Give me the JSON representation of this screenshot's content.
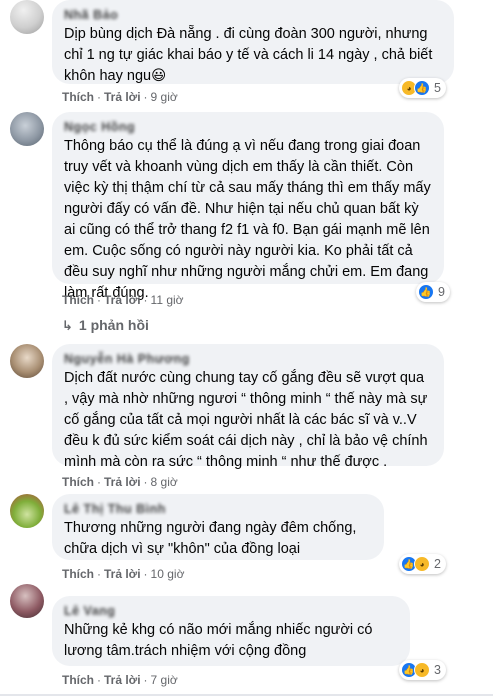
{
  "comments": [
    {
      "author": "Nhã Bảo",
      "text": "Dịp bùng dịch Đà nẵng . đi cùng đoàn 300 người, nhưng chỉ 1 ng tự giác khai báo y tế và cách li 14 ngày , chả biết khôn hay ngu😃",
      "like": "Thích",
      "reply": "Trả lời",
      "time": "9 giờ",
      "reaction_icons": [
        "sad-icon",
        "like-icon"
      ],
      "reaction_count": "5"
    },
    {
      "author": "Ngọc Hồng",
      "text": "Thông báo cụ thể là đúng ạ vì nếu đang trong giai đoan truy vết và khoanh vùng dịch em thấy là cần thiết. Còn việc kỳ thị thậm chí từ cả sau mấy tháng thì em thấy mấy người đấy có vấn đề. Như hiện tại nếu chủ quan bất kỳ ai cũng có thể trở thang f2 f1 và f0. Bạn gái mạnh mẽ lên em. Cuộc sống có người này người kia. Ko phải tất cả đều suy nghĩ như những người mắng chửi em. Em đang làm rất đúng.",
      "like": "Thích",
      "reply": "Trả lời",
      "time": "11 giờ",
      "reaction_icons": [
        "like-icon"
      ],
      "reaction_count": "9",
      "replies_label": "1 phản hồi"
    },
    {
      "author": "Nguyễn Hà Phương",
      "text": "Dịch đất nước cùng chung tay cố gắng đều sẽ vượt qua , vậy mà nhờ những ngươi “ thông minh “ thế này mà sự cố gắng của tất cả mọi người nhất là các bác sĩ và v..V đều k đủ sức kiểm soát cái dịch này , chỉ là bảo vệ chính mình mà còn ra sức “ thông minh “ như thế được .",
      "like": "Thích",
      "reply": "Trả lời",
      "time": "8 giờ"
    },
    {
      "author": "Lê Thị Thu Bình",
      "text": "Thương những người đang ngày đêm chống, chữa dịch vì sự \"khôn\" của đồng loại",
      "like": "Thích",
      "reply": "Trả lời",
      "time": "10 giờ",
      "reaction_icons": [
        "like-icon",
        "sad-icon"
      ],
      "reaction_count": "2"
    },
    {
      "author": "Lê Vang",
      "text": "Những kẻ khg có não mới mắng nhiếc người có lương tâm.trách nhiệm với cộng đồng",
      "like": "Thích",
      "reply": "Trả lời",
      "time": "7 giờ",
      "reaction_icons": [
        "like-icon",
        "sad-icon"
      ],
      "reaction_count": "3"
    }
  ]
}
